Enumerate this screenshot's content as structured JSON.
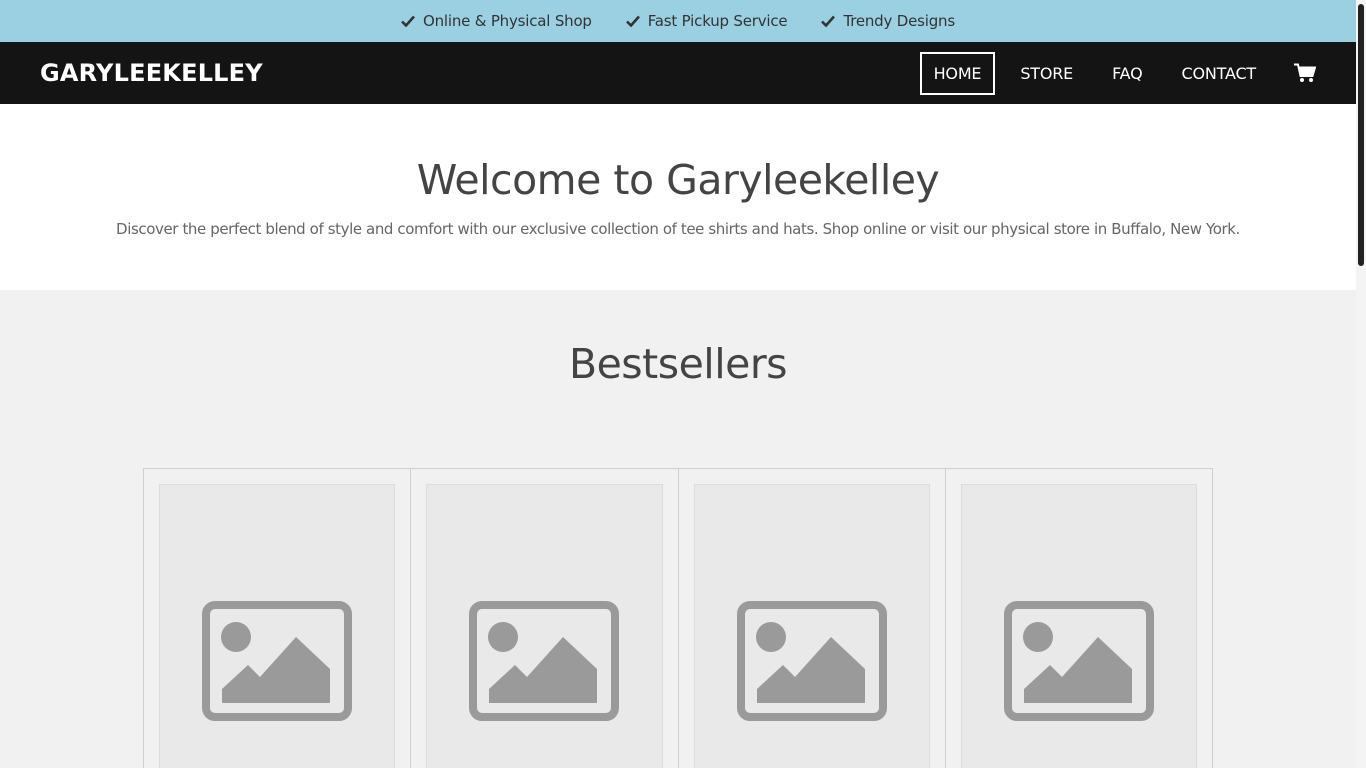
{
  "topbar": {
    "items": [
      {
        "icon": "check-icon",
        "label": "Online & Physical Shop"
      },
      {
        "icon": "check-icon",
        "label": "Fast Pickup Service"
      },
      {
        "icon": "check-icon",
        "label": "Trendy Designs"
      }
    ]
  },
  "navbar": {
    "brand": "GARYLEEKELLEY",
    "links": [
      "HOME",
      "STORE",
      "FAQ",
      "CONTACT"
    ],
    "active": "HOME",
    "cart_icon": "shopping-cart-icon"
  },
  "hero": {
    "title": "Welcome to Garyleekelley",
    "description": "Discover the perfect blend of style and comfort with our exclusive collection of tee shirts and hats. Shop online or visit our physical store in Buffalo, New York."
  },
  "bestsellers": {
    "title": "Bestsellers",
    "products": [
      {
        "image_icon": "image-placeholder-icon"
      },
      {
        "image_icon": "image-placeholder-icon"
      },
      {
        "image_icon": "image-placeholder-icon"
      },
      {
        "image_icon": "image-placeholder-icon"
      }
    ]
  },
  "colors": {
    "topbar_bg": "#9bcfe2",
    "navbar_bg": "#141414",
    "section_bg": "#f1f1f1",
    "placeholder_icon": "#9a9a9a"
  }
}
